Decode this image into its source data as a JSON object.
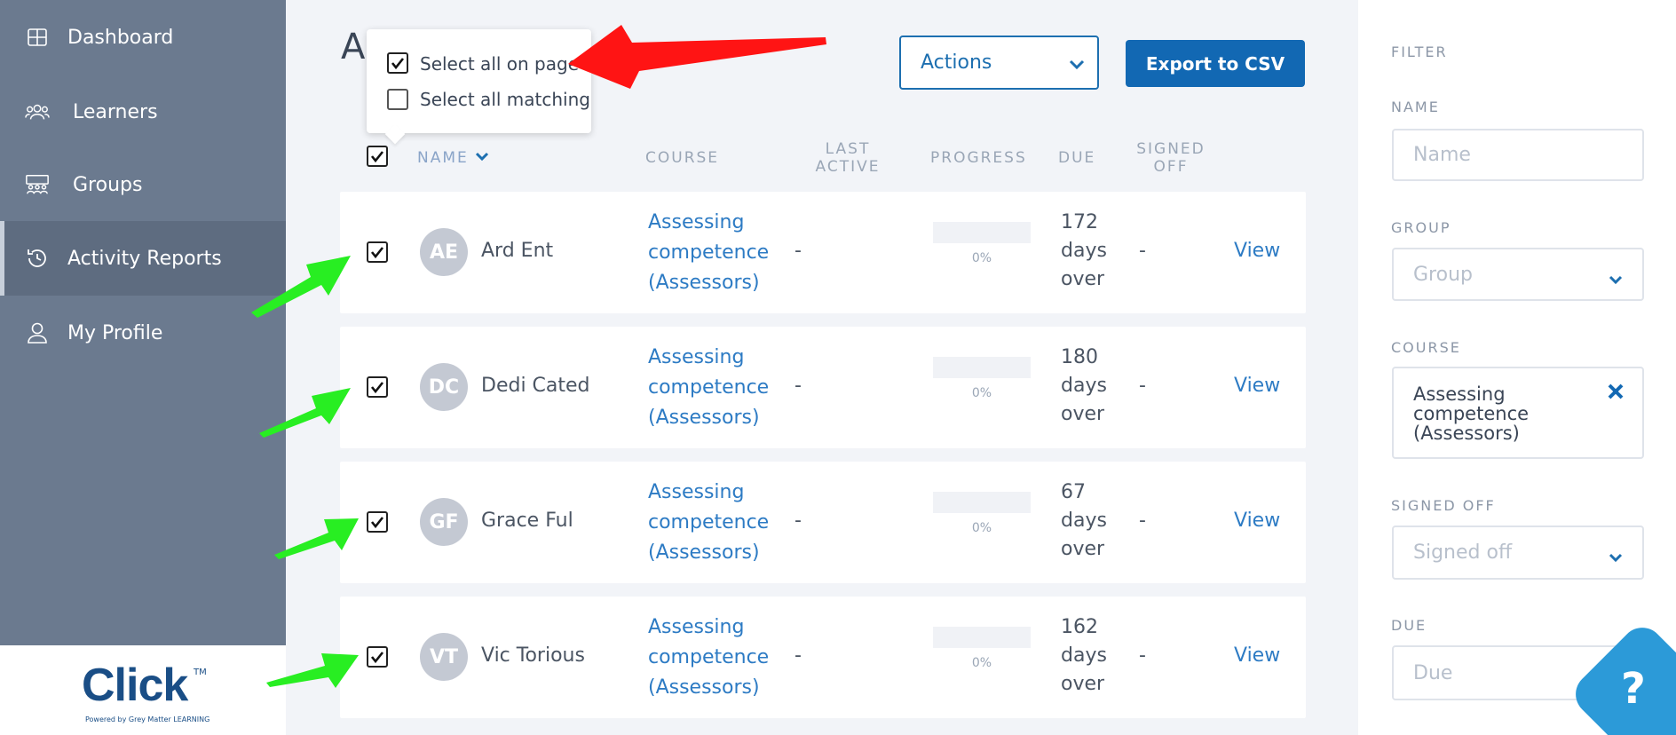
{
  "sidebar": {
    "items": [
      {
        "label": "Dashboard",
        "icon": "grid-icon"
      },
      {
        "label": "Learners",
        "icon": "users-icon"
      },
      {
        "label": "Groups",
        "icon": "groups-icon"
      },
      {
        "label": "Activity Reports",
        "icon": "history-icon",
        "active": true
      },
      {
        "label": "My Profile",
        "icon": "user-icon"
      }
    ],
    "logo": {
      "text": "Click",
      "tm": "TM",
      "sub": "Powered by Grey Matter LEARNING"
    }
  },
  "page": {
    "title_partial": "A",
    "actions_label": "Actions",
    "export_label": "Export to CSV"
  },
  "select_popup": {
    "option_page": "Select all on page",
    "option_matching": "Select all matching"
  },
  "table": {
    "headers": {
      "name": "NAME",
      "course": "COURSE",
      "last_active_1": "LAST",
      "last_active_2": "ACTIVE",
      "progress": "PROGRESS",
      "due": "DUE",
      "signed_off_1": "SIGNED",
      "signed_off_2": "OFF"
    },
    "rows": [
      {
        "initials": "AE",
        "name": "Ard Ent",
        "course_1": "Assessing",
        "course_2": "competence",
        "course_3": "(Assessors)",
        "last_active": "-",
        "progress": "0%",
        "progress_fraction": 0,
        "due_1": "172",
        "due_2": "days",
        "due_3": "over",
        "signed_off": "-",
        "view": "View",
        "checked": true
      },
      {
        "initials": "DC",
        "name": "Dedi Cated",
        "course_1": "Assessing",
        "course_2": "competence",
        "course_3": "(Assessors)",
        "last_active": "-",
        "progress": "0%",
        "progress_fraction": 0,
        "due_1": "180",
        "due_2": "days",
        "due_3": "over",
        "signed_off": "-",
        "view": "View",
        "checked": true
      },
      {
        "initials": "GF",
        "name": "Grace Ful",
        "course_1": "Assessing",
        "course_2": "competence",
        "course_3": "(Assessors)",
        "last_active": "-",
        "progress": "0%",
        "progress_fraction": 0,
        "due_1": "67",
        "due_2": "days",
        "due_3": "over",
        "signed_off": "-",
        "view": "View",
        "checked": true
      },
      {
        "initials": "VT",
        "name": "Vic Torious",
        "course_1": "Assessing",
        "course_2": "competence",
        "course_3": "(Assessors)",
        "last_active": "-",
        "progress": "0%",
        "progress_fraction": 0,
        "due_1": "162",
        "due_2": "days",
        "due_3": "over",
        "signed_off": "-",
        "view": "View",
        "checked": true
      }
    ]
  },
  "filter": {
    "heading": "FILTER",
    "name_label": "NAME",
    "name_placeholder": "Name",
    "group_label": "GROUP",
    "group_value": "Group",
    "course_label": "COURSE",
    "course_value_1": "Assessing",
    "course_value_2": "competence",
    "course_value_3": "(Assessors)",
    "signed_off_label": "SIGNED OFF",
    "signed_off_value": "Signed off",
    "due_label": "DUE",
    "due_placeholder": "Due"
  },
  "help": {
    "label": "?"
  },
  "colors": {
    "sidebar": "#6b7a8f",
    "accent": "#1268b3",
    "link": "#2d7bc4",
    "annotation_red": "#ff1a1a",
    "annotation_green": "#22ee22"
  }
}
